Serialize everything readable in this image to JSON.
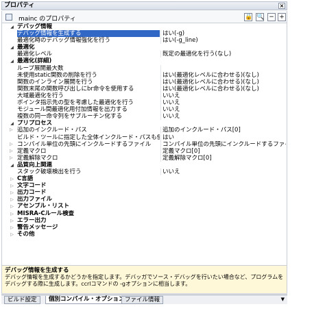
{
  "window": {
    "title": "プロパティ",
    "close_icon": "×"
  },
  "toolbar": {
    "title": "mainc のプロパティ",
    "btn_lock": "🔒",
    "btn_search": "🔍",
    "btn_minus": "−",
    "btn_plus": "+"
  },
  "rows": [
    {
      "type": "cat",
      "name": "デバッグ情報",
      "state": "open"
    },
    {
      "type": "prop",
      "name": "デバッグ情報を生成する",
      "value": "はい(-g)",
      "selected": true
    },
    {
      "type": "prop",
      "name": "最適化時のデバッグ情報強化を行う",
      "value": "はい(-g_line)"
    },
    {
      "type": "cat",
      "name": "最適化",
      "state": "open"
    },
    {
      "type": "prop",
      "name": "最適化レベル",
      "value": "既定の最適化を行う(なし)"
    },
    {
      "type": "cat",
      "name": "最適化(詳細)",
      "state": "open"
    },
    {
      "type": "prop",
      "name": "ループ展開最大数",
      "value": ""
    },
    {
      "type": "prop",
      "name": "未使用static関数の削除を行う",
      "value": "はい(最適化レベルに合わせる)(なし)"
    },
    {
      "type": "prop",
      "name": "関数のインライン展開を行う",
      "value": "はい(最適化レベルに合わせる)(なし)"
    },
    {
      "type": "prop",
      "name": "関数末尾の関数呼び出しにbr命令を使用する",
      "value": "はい(最適化レベルに合わせる)(なし)"
    },
    {
      "type": "prop",
      "name": "大域最適化を行う",
      "value": "いいえ"
    },
    {
      "type": "prop",
      "name": "ポインタ指示先の型を考慮した最適化を行う",
      "value": "いいえ"
    },
    {
      "type": "prop",
      "name": "モジュール間最適化用付加情報を出力する",
      "value": "いいえ"
    },
    {
      "type": "prop",
      "name": "複数の同一命令列をサブルーチン化する",
      "value": "いいえ"
    },
    {
      "type": "cat",
      "name": "プリプロセス",
      "state": "open"
    },
    {
      "type": "prop",
      "name": "追加のインクルード・パス",
      "value": "追加のインクルード・パス[0]",
      "expand": true
    },
    {
      "type": "prop",
      "name": "ビルド・ツールに指定した全体インクルード・パスも使用する",
      "value": "はい"
    },
    {
      "type": "prop",
      "name": "コンパイル単位の先頭にインクルードするファイル",
      "value": "コンパイル単位の先頭にインクルードするファイル[0]",
      "expand": true
    },
    {
      "type": "prop",
      "name": "定義マクロ",
      "value": "定義マクロ[0]",
      "expand": true
    },
    {
      "type": "prop",
      "name": "定義解除マクロ",
      "value": "定義解除マクロ[0]",
      "expand": true
    },
    {
      "type": "cat",
      "name": "品質向上関連",
      "state": "open"
    },
    {
      "type": "prop",
      "name": "スタック破壊検出を行う",
      "value": "いいえ"
    },
    {
      "type": "cat",
      "name": "C言語",
      "state": "closed"
    },
    {
      "type": "cat",
      "name": "文字コード",
      "state": "closed"
    },
    {
      "type": "cat",
      "name": "出力コード",
      "state": "closed"
    },
    {
      "type": "cat",
      "name": "出力ファイル",
      "state": "closed"
    },
    {
      "type": "cat",
      "name": "アセンブル・リスト",
      "state": "closed"
    },
    {
      "type": "cat",
      "name": "MISRA-Cルール検査",
      "state": "closed"
    },
    {
      "type": "cat",
      "name": "エラー出力",
      "state": "closed"
    },
    {
      "type": "cat",
      "name": "警告メッセージ",
      "state": "closed"
    },
    {
      "type": "cat",
      "name": "その他",
      "state": "closed"
    }
  ],
  "description": {
    "title": "デバッグ情報を生成する",
    "text": "デバッグ情報を生成するかどうかを指定します。デバッガでソース・デバッグを行いたい場合など、プログラムをデバッグする際に生成します。ccrlコマンドの -gオプションに相当します。"
  },
  "tabs": [
    {
      "label": "ビルド設定",
      "active": false
    },
    {
      "label": "個別コンパイル・オプション",
      "active": true
    },
    {
      "label": "ファイル情報",
      "active": false
    }
  ],
  "tab_menu": "▼"
}
